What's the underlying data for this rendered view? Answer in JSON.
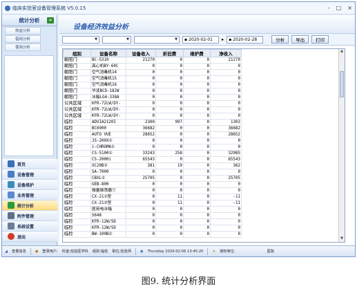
{
  "window": {
    "title": "临床实验室设备管理系统  V5.0.15",
    "controls": [
      "-",
      "□",
      "×"
    ]
  },
  "sidebar": {
    "header": "统计分析",
    "collapse_icon": "«",
    "sub_items": [
      "效益分析",
      "借用分析",
      "使用分析"
    ],
    "modules": [
      {
        "label": "首页",
        "icon": "home-icon",
        "color": "#3b6fb6"
      },
      {
        "label": "设备管理",
        "icon": "device-icon",
        "color": "#4a7fc0"
      },
      {
        "label": "设备维护",
        "icon": "maintenance-icon",
        "color": "#3c8dbc"
      },
      {
        "label": "业务管理",
        "icon": "business-icon",
        "color": "#5b8bd0"
      },
      {
        "label": "统计分析",
        "icon": "stats-icon",
        "color": "#2a9d3a"
      },
      {
        "label": "附件管理",
        "icon": "attachment-icon",
        "color": "#5d6f8a"
      },
      {
        "label": "系统设置",
        "icon": "settings-icon",
        "color": "#6b7d99"
      },
      {
        "label": "退出",
        "icon": "exit-icon",
        "color": "#d23a2a"
      }
    ]
  },
  "main": {
    "title": "设备经济效益分析",
    "toolbar": {
      "date_from": "2020-02-01",
      "date_to": "2020-02-28",
      "buttons": [
        "分析",
        "导出",
        "打印"
      ]
    },
    "table": {
      "columns": [
        "组别",
        "设备名称",
        "设备收入",
        "折旧费",
        "维护费",
        "净收入"
      ],
      "rows": [
        [
          "朝阳门",
          "BC-5310",
          "21270",
          "0",
          "0",
          "21270"
        ],
        [
          "朝阳门",
          "高心机BY-60C",
          "0",
          "0",
          "0",
          "0"
        ],
        [
          "朝阳门",
          "空气消毒机14",
          "0",
          "0",
          "0",
          "0"
        ],
        [
          "朝阳门",
          "空气消毒机15",
          "0",
          "0",
          "0",
          "0"
        ],
        [
          "朝阳门",
          "空气消毒机16",
          "0",
          "0",
          "0",
          "0"
        ],
        [
          "朝阳门",
          "华凌BCD-182W",
          "0",
          "0",
          "0",
          "0"
        ],
        [
          "朝阳门",
          "冰箱LG4-338A",
          "0",
          "0",
          "0",
          "0"
        ],
        [
          "公共区域",
          "KFR-72LW/DY-",
          "0",
          "0",
          "0",
          "0"
        ],
        [
          "公共区域",
          "KFR-72LW/DY-",
          "0",
          "0",
          "0",
          "0"
        ],
        [
          "公共区域",
          "KFR-72LW/DY-",
          "0",
          "0",
          "0",
          "0"
        ],
        [
          "临检",
          "ADVIA2120I",
          "2300",
          "997",
          "0",
          "1303"
        ],
        [
          "临检",
          "BC6900",
          "36682",
          "0",
          "0",
          "36682"
        ],
        [
          "临检",
          "AUTO VUE",
          "28652",
          "0",
          "0",
          "28652"
        ],
        [
          "临检",
          "JS-200X①",
          "0",
          "0",
          "0",
          "0"
        ],
        [
          "临检",
          "i-CHROMA①",
          "0",
          "0",
          "0",
          "0"
        ],
        [
          "临检",
          "CS-5100①",
          "33243",
          "258",
          "0",
          "32985"
        ],
        [
          "临检",
          "CS-2000i",
          "65543",
          "0",
          "0",
          "65543"
        ],
        [
          "临检",
          "XC20B①",
          "381",
          "19",
          "0",
          "362"
        ],
        [
          "临检",
          "SA-7000",
          "0",
          "0",
          "0",
          "0"
        ],
        [
          "临检",
          "CBXL①",
          "25705",
          "0",
          "0",
          "25705"
        ],
        [
          "临检",
          "GEB-800",
          "0",
          "0",
          "0",
          "0"
        ],
        [
          "临检",
          "微量振荡器①",
          "0",
          "0",
          "0",
          "0"
        ],
        [
          "临检",
          "CX-21①型",
          "0",
          "11",
          "0",
          "-11"
        ],
        [
          "临检",
          "CX-21②型",
          "0",
          "11",
          "0",
          "-11"
        ],
        [
          "临检",
          "医用电冰箱",
          "0",
          "0",
          "0",
          "0"
        ],
        [
          "临检",
          "S648",
          "0",
          "0",
          "0",
          "0"
        ],
        [
          "临检",
          "KFR-12W/SD",
          "0",
          "0",
          "0",
          "0"
        ],
        [
          "临检",
          "KFR-12W/SD",
          "0",
          "0",
          "0",
          "0"
        ],
        [
          "临检",
          "BW-100B①",
          "0",
          "0",
          "0",
          "0"
        ]
      ]
    }
  },
  "statusbar": {
    "items": [
      "查看信息",
      "登录用户:",
      "科室:检验医学科",
      "组别:临检",
      "职位:检验师",
      "Thursday  2020-02-06  13:45:20",
      "授权单位:",
      "医院"
    ]
  },
  "caption": "图9. 统计分析界面"
}
